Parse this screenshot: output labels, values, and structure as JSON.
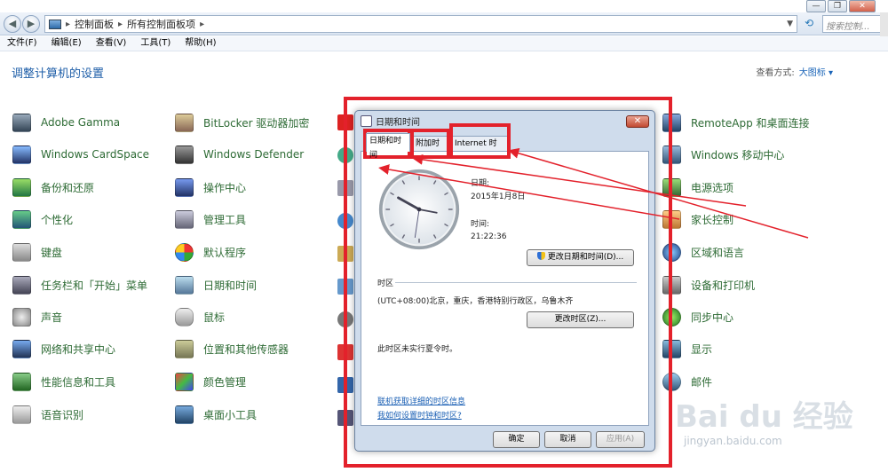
{
  "window": {
    "breadcrumb": [
      "控制面板",
      "所有控制面板项"
    ],
    "search_placeholder": "搜索控制..."
  },
  "menu": [
    "文件(F)",
    "编辑(E)",
    "查看(V)",
    "工具(T)",
    "帮助(H)"
  ],
  "page_title": "调整计算机的设置",
  "view_by": {
    "label": "查看方式:",
    "value": "大图标 ▾"
  },
  "items_col1": [
    "Adobe Gamma",
    "Windows CardSpace",
    "备份和还原",
    "个性化",
    "键盘",
    "任务栏和「开始」菜单",
    "声音",
    "网络和共享中心",
    "性能信息和工具",
    "语音识别"
  ],
  "items_col2": [
    "BitLocker 驱动器加密",
    "Windows Defender",
    "操作中心",
    "管理工具",
    "默认程序",
    "日期和时间",
    "鼠标",
    "位置和其他传感器",
    "颜色管理",
    "桌面小工具"
  ],
  "items_col4": [
    "RemoteApp 和桌面连接",
    "Windows 移动中心",
    "电源选项",
    "家长控制",
    "区域和语言",
    "设备和打印机",
    "同步中心",
    "显示",
    "邮件"
  ],
  "dialog": {
    "title": "日期和时间",
    "tabs": [
      "日期和时间",
      "附加时钟",
      "Internet 时间"
    ],
    "date_label": "日期:",
    "date_value": "2015年1月8日",
    "time_label": "时间:",
    "time_value": "21:22:36",
    "change_datetime_btn": "更改日期和时间(D)...",
    "timezone_header": "时区",
    "timezone_value": "(UTC+08:00)北京，重庆，香港特别行政区，乌鲁木齐",
    "change_timezone_btn": "更改时区(Z)...",
    "dst_note": "此时区未实行夏令时。",
    "link1": "联机获取详细的时区信息",
    "link2": "我如何设置时钟和时区?",
    "ok": "确定",
    "cancel": "取消",
    "apply": "应用(A)"
  },
  "watermark": {
    "brand": "Bai du 经验",
    "url": "jingyan.baidu.com"
  },
  "colors": {
    "annotation_red": "#e3212b",
    "link_blue": "#1a5fb4",
    "item_green": "#2e6b35"
  }
}
